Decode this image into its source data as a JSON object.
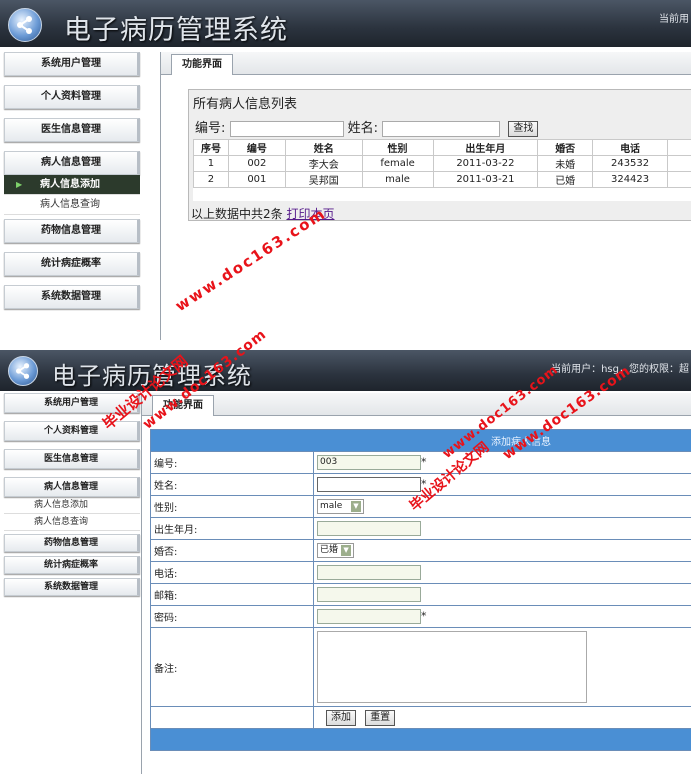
{
  "app": {
    "title": "电子病历管理系统",
    "user_info_top": "当前用",
    "user_info_bottom": "当前用户：hsg，您的权限：超"
  },
  "sidebar": {
    "items": [
      "系统用户管理",
      "个人资料管理",
      "医生信息管理",
      "病人信息管理"
    ],
    "sub_items": [
      "病人信息添加",
      "病人信息查询"
    ],
    "items_after": [
      "药物信息管理",
      "统计病症概率",
      "系统数据管理"
    ]
  },
  "tab_label": "功能界面",
  "patient_list": {
    "title": "所有病人信息列表",
    "search_id_label": "编号:",
    "search_name_label": "姓名:",
    "search_button": "查找",
    "columns": [
      "序号",
      "编号",
      "姓名",
      "性别",
      "出生年月",
      "婚否",
      "电话"
    ],
    "rows": [
      [
        "1",
        "002",
        "李大会",
        "female",
        "2011-03-22",
        "未婚",
        "243532"
      ],
      [
        "2",
        "001",
        "吴邦国",
        "male",
        "2011-03-21",
        "已婚",
        "324423"
      ]
    ],
    "summary": "以上数据中共2条",
    "print_link": "打印本页"
  },
  "add_form": {
    "header": "添加病人信息",
    "fields": {
      "id": {
        "label": "编号:",
        "value": "003"
      },
      "name": {
        "label": "姓名:",
        "value": ""
      },
      "gender": {
        "label": "性别:",
        "value": "male"
      },
      "birth": {
        "label": "出生年月:",
        "value": ""
      },
      "married": {
        "label": "婚否:",
        "value": "已婚"
      },
      "phone": {
        "label": "电话:",
        "value": ""
      },
      "email": {
        "label": "邮箱:",
        "value": ""
      },
      "password": {
        "label": "密码:",
        "value": ""
      },
      "notes": {
        "label": "备注:",
        "value": ""
      }
    },
    "required_mark": "*",
    "add_button": "添加",
    "reset_button": "重置"
  },
  "watermarks": [
    "www.doc163.com",
    "毕业设计论文网"
  ],
  "colors": {
    "header_bg": "#2b333e",
    "form_header": "#4a8fd4",
    "watermark": "#e8131a",
    "active_menu": "#2c3a2c"
  }
}
